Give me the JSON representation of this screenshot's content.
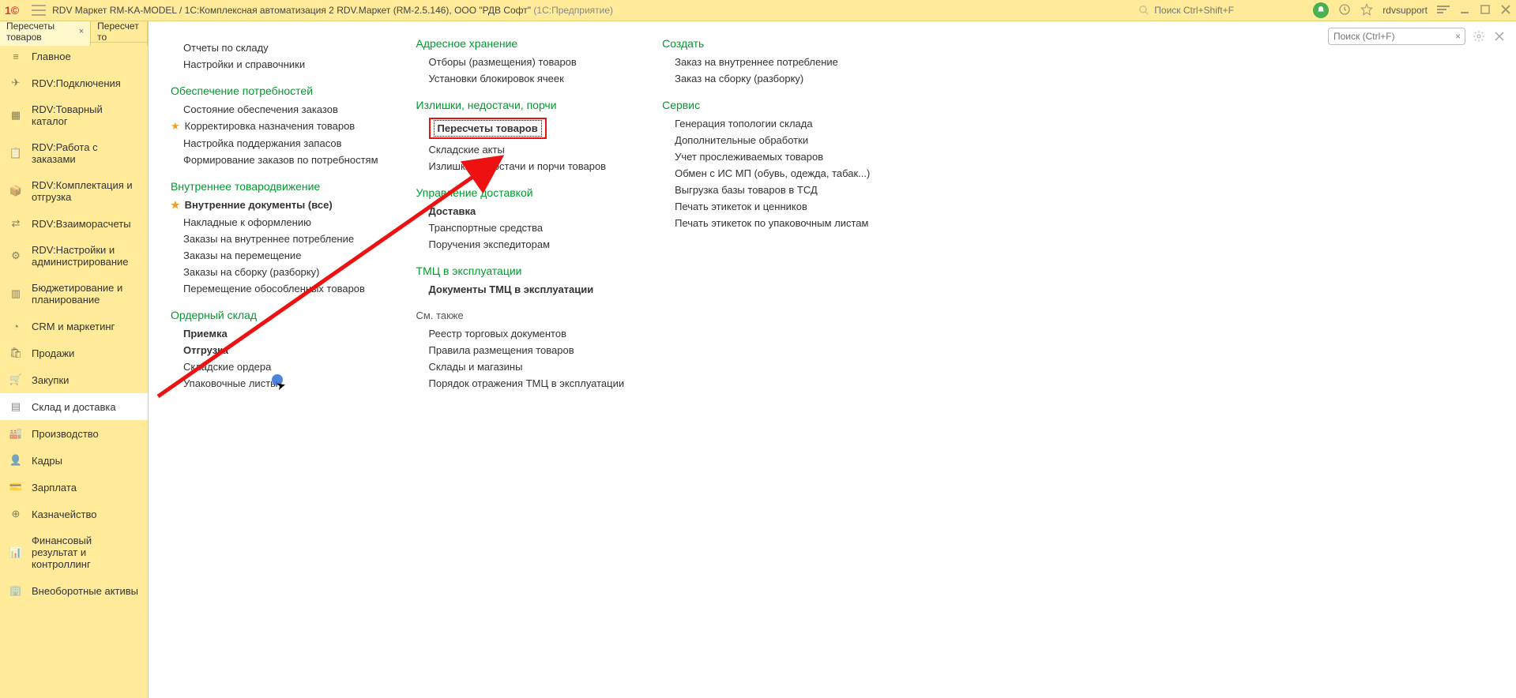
{
  "topbar": {
    "title_main": "RDV Маркет RM-KA-MODEL / 1С:Комплексная автоматизация 2 RDV.Маркет (RM-2.5.146), ООО \"РДВ Софт\"",
    "title_suffix": "(1С:Предприятие)",
    "search_placeholder": "Поиск Ctrl+Shift+F",
    "user": "rdvsupport"
  },
  "tabs": {
    "t0": "Пересчеты товаров",
    "t1": "Пересчет то"
  },
  "sidebar": {
    "items": [
      {
        "label": "Главное"
      },
      {
        "label": "RDV:Подключения"
      },
      {
        "label": "RDV:Товарный каталог"
      },
      {
        "label": "RDV:Работа с заказами"
      },
      {
        "label": "RDV:Комплектация и отгрузка"
      },
      {
        "label": "RDV:Взаиморасчеты"
      },
      {
        "label": "RDV:Настройки и администрирование"
      },
      {
        "label": "Бюджетирование и планирование"
      },
      {
        "label": "CRM и маркетинг"
      },
      {
        "label": "Продажи"
      },
      {
        "label": "Закупки"
      },
      {
        "label": "Склад и доставка"
      },
      {
        "label": "Производство"
      },
      {
        "label": "Кадры"
      },
      {
        "label": "Зарплата"
      },
      {
        "label": "Казначейство"
      },
      {
        "label": "Финансовый результат и контроллинг"
      },
      {
        "label": "Внеоборотные активы"
      }
    ]
  },
  "content": {
    "search_placeholder": "Поиск (Ctrl+F)",
    "col1": {
      "s0": {
        "title": "",
        "links": [
          "Отчеты по складу",
          "Настройки и справочники"
        ]
      },
      "s1": {
        "title": "Обеспечение потребностей",
        "links": [
          "Состояние обеспечения заказов",
          "Корректировка назначения товаров",
          "Настройка поддержания запасов",
          "Формирование заказов по потребностям"
        ]
      },
      "s2": {
        "title": "Внутреннее товародвижение",
        "links": [
          "Внутренние документы (все)",
          "Накладные к оформлению",
          "Заказы на внутреннее потребление",
          "Заказы на перемещение",
          "Заказы на сборку (разборку)",
          "Перемещение обособленных товаров"
        ]
      },
      "s3": {
        "title": "Ордерный склад",
        "links": [
          "Приемка",
          "Отгрузка",
          "Складские ордера",
          "Упаковочные листы"
        ]
      }
    },
    "col2": {
      "s0": {
        "title": "Адресное хранение",
        "links": [
          "Отборы (размещения) товаров",
          "Установки блокировок ячеек"
        ]
      },
      "s1": {
        "title": "Излишки, недостачи, порчи",
        "links": [
          "Пересчеты товаров",
          "Складские акты",
          "Излишки, недостачи и порчи товаров"
        ]
      },
      "s2": {
        "title": "Управление доставкой",
        "links": [
          "Доставка",
          "Транспортные средства",
          "Поручения экспедиторам"
        ]
      },
      "s3": {
        "title": "ТМЦ в эксплуатации",
        "links": [
          "Документы ТМЦ в эксплуатации"
        ]
      },
      "s4": {
        "title": "См. также",
        "links": [
          "Реестр торговых документов",
          "Правила размещения товаров",
          "Склады и магазины",
          "Порядок отражения ТМЦ в эксплуатации"
        ]
      }
    },
    "col3": {
      "s0": {
        "title": "Создать",
        "links": [
          "Заказ на внутреннее потребление",
          "Заказ на сборку (разборку)"
        ]
      },
      "s1": {
        "title": "Сервис",
        "links": [
          "Генерация топологии склада",
          "Дополнительные обработки",
          "Учет прослеживаемых товаров",
          "Обмен с ИС МП (обувь, одежда, табак...)",
          "Выгрузка базы товаров в ТСД",
          "Печать этикеток и ценников",
          "Печать этикеток по упаковочным листам"
        ]
      }
    }
  }
}
